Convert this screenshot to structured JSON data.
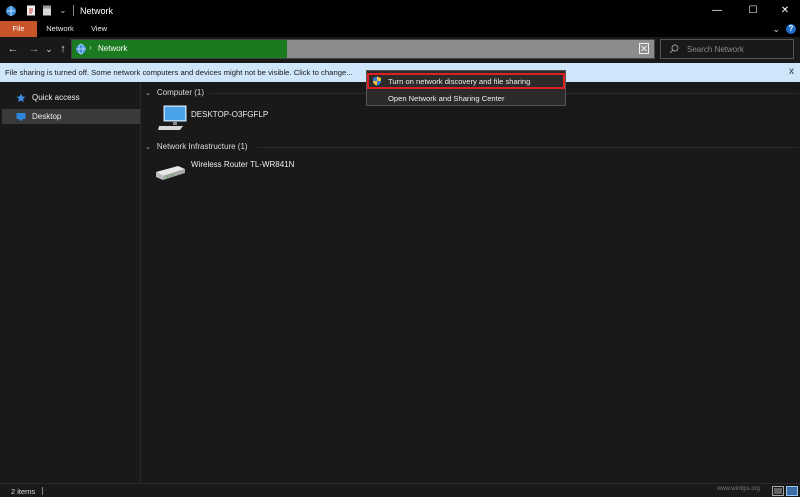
{
  "window": {
    "title": "Network",
    "controls": {
      "minimize": "—",
      "maximize": "☐",
      "close": "✕"
    }
  },
  "ribbon": {
    "tabs": [
      "File",
      "Network",
      "View"
    ],
    "help": "?"
  },
  "nav": {
    "back": "←",
    "forward": "→",
    "recent": "⌄",
    "up": "↑"
  },
  "address": {
    "path": "Network",
    "progress_percent": 37
  },
  "search": {
    "placeholder": "Search Network"
  },
  "infobar": {
    "message": "File sharing is turned off. Some network computers and devices might not be visible. Click to change...",
    "close": "x"
  },
  "sidebar": {
    "items": [
      {
        "label": "Quick access",
        "icon": "star-icon"
      },
      {
        "label": "Desktop",
        "icon": "desktop-folder-icon"
      }
    ]
  },
  "groups": [
    {
      "label": "Computer (1)",
      "items": [
        {
          "label": "DESKTOP-O3FGFLP",
          "icon": "computer-icon"
        }
      ]
    },
    {
      "label": "Network Infrastructure (1)",
      "items": [
        {
          "label": "Wireless Router TL-WR841N",
          "icon": "router-icon"
        }
      ]
    }
  ],
  "context_menu": {
    "items": [
      {
        "label": "Turn on network discovery and file sharing",
        "icon": "shield-icon",
        "highlighted": true
      },
      {
        "label": "Open Network and Sharing Center",
        "icon": "",
        "highlighted": false
      }
    ]
  },
  "status": {
    "count": "2 items",
    "watermark": "www.wintips.org"
  },
  "colors": {
    "accent_file_tab": "#c8552a",
    "address_progress": "#1a7a1f",
    "infobar_bg": "#cfe5f9",
    "highlight_outline": "#e02020"
  }
}
